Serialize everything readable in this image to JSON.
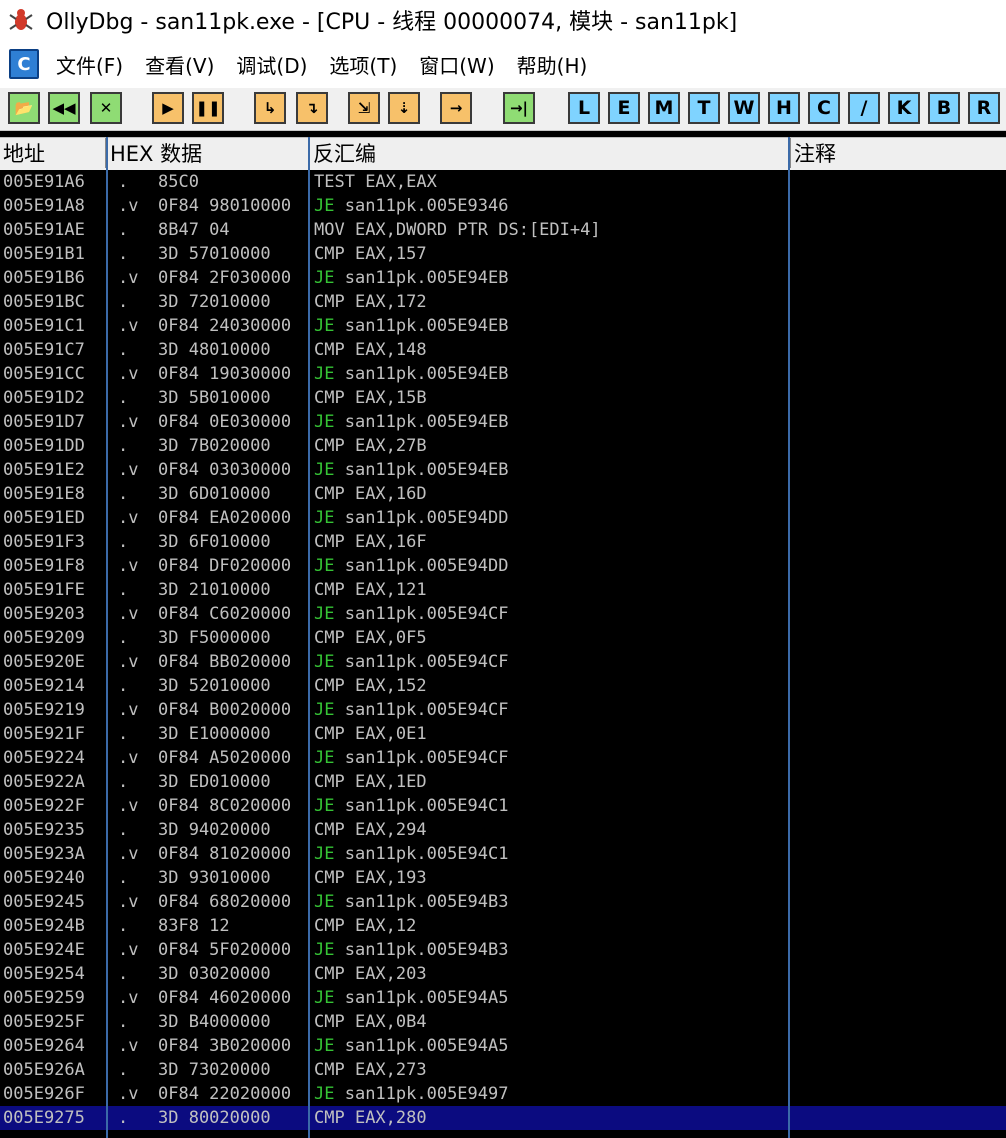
{
  "window": {
    "title": "OllyDbg - san11pk.exe - [CPU - 线程 00000074, 模块 - san11pk]",
    "app_icon": "bug-icon"
  },
  "menu": {
    "icon_label": "C",
    "items": [
      "文件(F)",
      "查看(V)",
      "调试(D)",
      "选项(T)",
      "窗口(W)",
      "帮助(H)"
    ]
  },
  "toolbar": {
    "buttons": [
      {
        "name": "open-icon",
        "glyph": "📂",
        "color": "green"
      },
      {
        "name": "restart-icon",
        "glyph": "◀◀",
        "color": "green"
      },
      {
        "name": "close-icon",
        "glyph": "✕",
        "color": "green"
      },
      {
        "name": "run-icon",
        "glyph": "▶",
        "color": "orange"
      },
      {
        "name": "pause-icon",
        "glyph": "❚❚",
        "color": "orange"
      },
      {
        "name": "step-into-icon",
        "glyph": "↳",
        "color": "orange"
      },
      {
        "name": "step-over-icon",
        "glyph": "↴",
        "color": "orange"
      },
      {
        "name": "trace-into-icon",
        "glyph": "⇲",
        "color": "orange"
      },
      {
        "name": "trace-over-icon",
        "glyph": "⇣",
        "color": "orange"
      },
      {
        "name": "execute-till-return-icon",
        "glyph": "→",
        "color": "orange"
      },
      {
        "name": "goto-icon",
        "glyph": "→|",
        "color": "green"
      }
    ],
    "letters": [
      "L",
      "E",
      "M",
      "T",
      "W",
      "H",
      "C",
      "/",
      "K",
      "B",
      "R"
    ]
  },
  "columns": {
    "address": "地址",
    "hex": "HEX 数据",
    "disasm": "反汇编",
    "comment": "注释"
  },
  "colors": {
    "listing_bg": "#000000",
    "listing_text": "#c0c0c0",
    "je_mnemonic": "#35c335",
    "selection": "#0b0b80"
  },
  "rows": [
    {
      "addr": "005E91A6",
      "mark": ".",
      "hex": "85C0",
      "mn": "TEST",
      "ops": " EAX,EAX"
    },
    {
      "addr": "005E91A8",
      "mark": ".v",
      "hex": "0F84 98010000",
      "mn": "JE",
      "ops": " san11pk.005E9346"
    },
    {
      "addr": "005E91AE",
      "mark": ".",
      "hex": "8B47 04",
      "mn": "MOV",
      "ops": " EAX,DWORD PTR DS:[EDI+4]"
    },
    {
      "addr": "005E91B1",
      "mark": ".",
      "hex": "3D 57010000",
      "mn": "CMP",
      "ops": " EAX,157"
    },
    {
      "addr": "005E91B6",
      "mark": ".v",
      "hex": "0F84 2F030000",
      "mn": "JE",
      "ops": " san11pk.005E94EB"
    },
    {
      "addr": "005E91BC",
      "mark": ".",
      "hex": "3D 72010000",
      "mn": "CMP",
      "ops": " EAX,172"
    },
    {
      "addr": "005E91C1",
      "mark": ".v",
      "hex": "0F84 24030000",
      "mn": "JE",
      "ops": " san11pk.005E94EB"
    },
    {
      "addr": "005E91C7",
      "mark": ".",
      "hex": "3D 48010000",
      "mn": "CMP",
      "ops": " EAX,148"
    },
    {
      "addr": "005E91CC",
      "mark": ".v",
      "hex": "0F84 19030000",
      "mn": "JE",
      "ops": " san11pk.005E94EB"
    },
    {
      "addr": "005E91D2",
      "mark": ".",
      "hex": "3D 5B010000",
      "mn": "CMP",
      "ops": " EAX,15B"
    },
    {
      "addr": "005E91D7",
      "mark": ".v",
      "hex": "0F84 0E030000",
      "mn": "JE",
      "ops": " san11pk.005E94EB"
    },
    {
      "addr": "005E91DD",
      "mark": ".",
      "hex": "3D 7B020000",
      "mn": "CMP",
      "ops": " EAX,27B"
    },
    {
      "addr": "005E91E2",
      "mark": ".v",
      "hex": "0F84 03030000",
      "mn": "JE",
      "ops": " san11pk.005E94EB"
    },
    {
      "addr": "005E91E8",
      "mark": ".",
      "hex": "3D 6D010000",
      "mn": "CMP",
      "ops": " EAX,16D"
    },
    {
      "addr": "005E91ED",
      "mark": ".v",
      "hex": "0F84 EA020000",
      "mn": "JE",
      "ops": " san11pk.005E94DD"
    },
    {
      "addr": "005E91F3",
      "mark": ".",
      "hex": "3D 6F010000",
      "mn": "CMP",
      "ops": " EAX,16F"
    },
    {
      "addr": "005E91F8",
      "mark": ".v",
      "hex": "0F84 DF020000",
      "mn": "JE",
      "ops": " san11pk.005E94DD"
    },
    {
      "addr": "005E91FE",
      "mark": ".",
      "hex": "3D 21010000",
      "mn": "CMP",
      "ops": " EAX,121"
    },
    {
      "addr": "005E9203",
      "mark": ".v",
      "hex": "0F84 C6020000",
      "mn": "JE",
      "ops": " san11pk.005E94CF"
    },
    {
      "addr": "005E9209",
      "mark": ".",
      "hex": "3D F5000000",
      "mn": "CMP",
      "ops": " EAX,0F5"
    },
    {
      "addr": "005E920E",
      "mark": ".v",
      "hex": "0F84 BB020000",
      "mn": "JE",
      "ops": " san11pk.005E94CF"
    },
    {
      "addr": "005E9214",
      "mark": ".",
      "hex": "3D 52010000",
      "mn": "CMP",
      "ops": " EAX,152"
    },
    {
      "addr": "005E9219",
      "mark": ".v",
      "hex": "0F84 B0020000",
      "mn": "JE",
      "ops": " san11pk.005E94CF"
    },
    {
      "addr": "005E921F",
      "mark": ".",
      "hex": "3D E1000000",
      "mn": "CMP",
      "ops": " EAX,0E1"
    },
    {
      "addr": "005E9224",
      "mark": ".v",
      "hex": "0F84 A5020000",
      "mn": "JE",
      "ops": " san11pk.005E94CF"
    },
    {
      "addr": "005E922A",
      "mark": ".",
      "hex": "3D ED010000",
      "mn": "CMP",
      "ops": " EAX,1ED"
    },
    {
      "addr": "005E922F",
      "mark": ".v",
      "hex": "0F84 8C020000",
      "mn": "JE",
      "ops": " san11pk.005E94C1"
    },
    {
      "addr": "005E9235",
      "mark": ".",
      "hex": "3D 94020000",
      "mn": "CMP",
      "ops": " EAX,294"
    },
    {
      "addr": "005E923A",
      "mark": ".v",
      "hex": "0F84 81020000",
      "mn": "JE",
      "ops": " san11pk.005E94C1"
    },
    {
      "addr": "005E9240",
      "mark": ".",
      "hex": "3D 93010000",
      "mn": "CMP",
      "ops": " EAX,193"
    },
    {
      "addr": "005E9245",
      "mark": ".v",
      "hex": "0F84 68020000",
      "mn": "JE",
      "ops": " san11pk.005E94B3"
    },
    {
      "addr": "005E924B",
      "mark": ".",
      "hex": "83F8 12",
      "mn": "CMP",
      "ops": " EAX,12"
    },
    {
      "addr": "005E924E",
      "mark": ".v",
      "hex": "0F84 5F020000",
      "mn": "JE",
      "ops": " san11pk.005E94B3"
    },
    {
      "addr": "005E9254",
      "mark": ".",
      "hex": "3D 03020000",
      "mn": "CMP",
      "ops": " EAX,203"
    },
    {
      "addr": "005E9259",
      "mark": ".v",
      "hex": "0F84 46020000",
      "mn": "JE",
      "ops": " san11pk.005E94A5"
    },
    {
      "addr": "005E925F",
      "mark": ".",
      "hex": "3D B4000000",
      "mn": "CMP",
      "ops": " EAX,0B4"
    },
    {
      "addr": "005E9264",
      "mark": ".v",
      "hex": "0F84 3B020000",
      "mn": "JE",
      "ops": " san11pk.005E94A5"
    },
    {
      "addr": "005E926A",
      "mark": ".",
      "hex": "3D 73020000",
      "mn": "CMP",
      "ops": " EAX,273"
    },
    {
      "addr": "005E926F",
      "mark": ".v",
      "hex": "0F84 22020000",
      "mn": "JE",
      "ops": " san11pk.005E9497"
    },
    {
      "addr": "005E9275",
      "mark": ".",
      "hex": "3D 80020000",
      "mn": "CMP",
      "ops": " EAX,280",
      "selected": true
    }
  ]
}
